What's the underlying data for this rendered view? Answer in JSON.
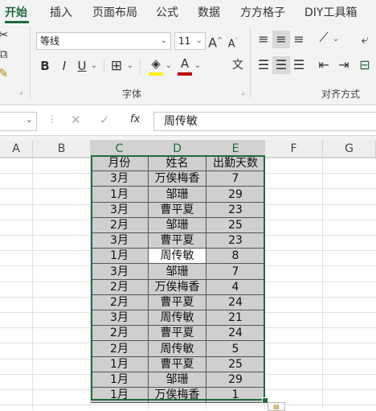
{
  "ribbon_tabs": [
    "开始",
    "插入",
    "页面布局",
    "公式",
    "数据",
    "方方格子",
    "DIY工具箱"
  ],
  "active_tab": "开始",
  "font": {
    "name": "等线",
    "size": "11"
  },
  "buttons": {
    "increase_font": "A",
    "decrease_font": "A",
    "bold": "B",
    "italic": "I",
    "underline": "U",
    "font_color": "A"
  },
  "group_labels": {
    "font": "字体",
    "alignment": "对齐方式"
  },
  "formula_bar": {
    "fx": "fx",
    "content": "周传敏"
  },
  "column_headers": [
    "A",
    "B",
    "C",
    "D",
    "E",
    "F",
    "G"
  ],
  "selected_columns": [
    "C",
    "D",
    "E"
  ],
  "table": {
    "headers": [
      "月份",
      "姓名",
      "出勤天数"
    ],
    "rows": [
      [
        "3月",
        "万俟梅香",
        "7"
      ],
      [
        "1月",
        "邹珊",
        "29"
      ],
      [
        "3月",
        "曹平夏",
        "23"
      ],
      [
        "2月",
        "邹珊",
        "25"
      ],
      [
        "3月",
        "曹平夏",
        "23"
      ],
      [
        "1月",
        "周传敏",
        "8"
      ],
      [
        "3月",
        "邹珊",
        "7"
      ],
      [
        "2月",
        "万俟梅香",
        "4"
      ],
      [
        "2月",
        "曹平夏",
        "24"
      ],
      [
        "3月",
        "周传敏",
        "21"
      ],
      [
        "2月",
        "曹平夏",
        "24"
      ],
      [
        "2月",
        "周传敏",
        "5"
      ],
      [
        "1月",
        "曹平夏",
        "25"
      ],
      [
        "1月",
        "邹珊",
        "29"
      ],
      [
        "1月",
        "万俟梅香",
        "1"
      ]
    ]
  },
  "active_cell": {
    "row": 5,
    "col": 1
  },
  "colors": {
    "accent": "#1e6b3c",
    "selection_fill": "#cfcfcf",
    "font_color_bar": "#c00000"
  }
}
